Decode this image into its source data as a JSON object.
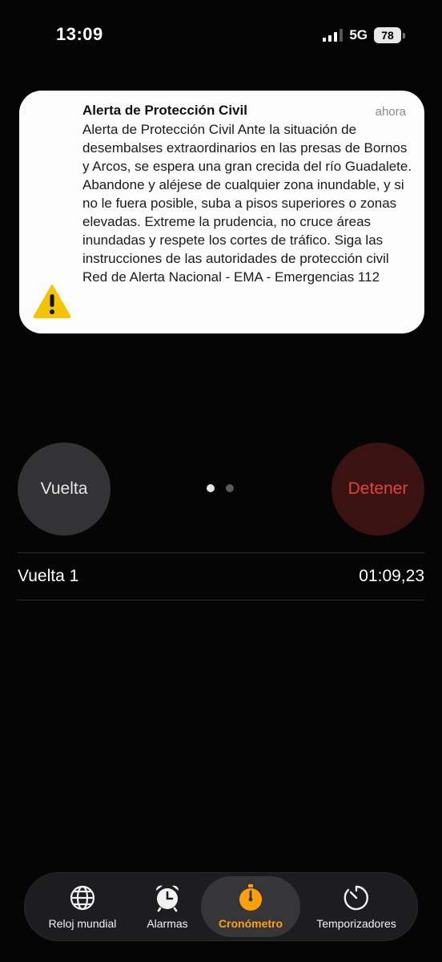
{
  "status_bar": {
    "time": "13:09",
    "network": "5G",
    "battery": "78"
  },
  "notification": {
    "title": "Alerta de Protección Civil",
    "time": "ahora",
    "body": "Alerta de Protección Civil Ante la situación de desembalses extraordinarios en las presas de Bornos y Arcos, se espera una gran crecida del río Guadalete. Abandone y aléjese de cualquier zona inundable,  y si no le fuera posible, suba a pisos superiores o zonas elevadas. Extreme la prudencia, no cruce áreas inundadas y respete los cortes de tráfico. Siga las instrucciones de las autoridades de protección civil Red de Alerta Nacional - EMA - Emergencias 112",
    "icon": "warning-icon"
  },
  "controls": {
    "lap_label": "Vuelta",
    "stop_label": "Detener",
    "page_count": 2,
    "active_page": 1
  },
  "laps": [
    {
      "label": "Vuelta 1",
      "time": "01:09,23"
    }
  ],
  "tabs": [
    {
      "label": "Reloj mundial",
      "icon": "globe-icon"
    },
    {
      "label": "Alarmas",
      "icon": "alarm-clock-icon"
    },
    {
      "label": "Cronómetro",
      "icon": "stopwatch-icon",
      "active": true
    },
    {
      "label": "Temporizadores",
      "icon": "timer-icon"
    }
  ],
  "colors": {
    "accent": "#ff9f0a",
    "stop_red": "#e0453d",
    "warning_yellow": "#f5c400"
  }
}
